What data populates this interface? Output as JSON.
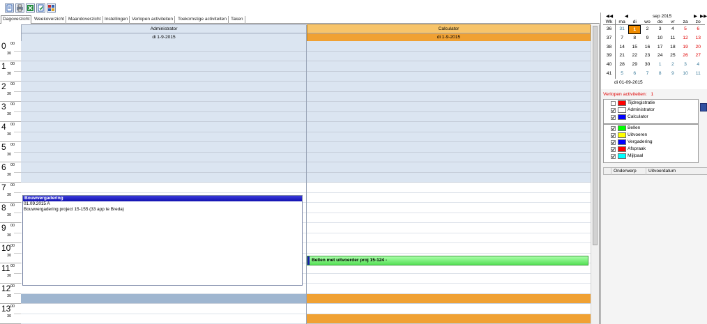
{
  "toolbar": {
    "icons": [
      "new-document-icon",
      "print-icon",
      "excel-export-icon",
      "refresh-icon",
      "grid-view-icon"
    ]
  },
  "tabs": [
    {
      "label": "Dagoverzicht",
      "active": true
    },
    {
      "label": "Weekoverzicht",
      "active": false
    },
    {
      "label": "Maandoverzicht",
      "active": false
    },
    {
      "label": "Instellingen",
      "active": false
    },
    {
      "label": "Verlopen activiteiten",
      "active": false
    },
    {
      "label": "Toekomstige activiteiten",
      "active": false
    },
    {
      "label": "Taken",
      "active": false
    }
  ],
  "columns": [
    {
      "name": "Administrator",
      "date": "di 1-9-2015"
    },
    {
      "name": "Calculator",
      "date": "di 1-9-2015"
    }
  ],
  "hours": [
    "0",
    "1",
    "2",
    "3",
    "4",
    "5",
    "6",
    "7",
    "8",
    "9",
    "10",
    "11",
    "12",
    "13"
  ],
  "minute_labels": {
    "full": "00",
    "half": "30"
  },
  "events": [
    {
      "title": "Bouwvergadering",
      "lines": [
        "01.09.2015 A",
        "Bouwvergadering project 15-155 (33 app te Breda)"
      ]
    },
    {
      "title": "Bellen met uitvoerder proj 15-124 -",
      "lines": []
    }
  ],
  "mini_calendar": {
    "month_label": "sep 2015",
    "header": [
      "Wk",
      "ma",
      "di",
      "wo",
      "do",
      "vr",
      "za",
      "zo"
    ],
    "weeks": [
      {
        "wk": "36",
        "days": [
          "31",
          "1",
          "2",
          "3",
          "4",
          "5",
          "6"
        ]
      },
      {
        "wk": "37",
        "days": [
          "7",
          "8",
          "9",
          "10",
          "11",
          "12",
          "13"
        ]
      },
      {
        "wk": "38",
        "days": [
          "14",
          "15",
          "16",
          "17",
          "18",
          "19",
          "20"
        ]
      },
      {
        "wk": "39",
        "days": [
          "21",
          "22",
          "23",
          "24",
          "25",
          "26",
          "27"
        ]
      },
      {
        "wk": "40",
        "days": [
          "28",
          "29",
          "30",
          "1",
          "2",
          "3",
          "4"
        ]
      },
      {
        "wk": "41",
        "days": [
          "5",
          "6",
          "7",
          "8",
          "9",
          "10",
          "11"
        ]
      }
    ],
    "selected_date": "di 01-09-2015"
  },
  "overdue": {
    "label": "Verlopen activiteiten:",
    "count": "1"
  },
  "resources": [
    {
      "label": "Tijdregistratie",
      "checked": false,
      "color": "#ff0000"
    },
    {
      "label": "Administrator",
      "checked": true,
      "color": "#ffffff"
    },
    {
      "label": "Calculator",
      "checked": true,
      "color": "#0000ff"
    }
  ],
  "activity_types": [
    {
      "label": "Bellen",
      "checked": true,
      "color": "#00ff00"
    },
    {
      "label": "Uitvoeren",
      "checked": true,
      "color": "#ffff00"
    },
    {
      "label": "Vergadering",
      "checked": true,
      "color": "#0000ff"
    },
    {
      "label": "Afspraak",
      "checked": true,
      "color": "#ff0000"
    },
    {
      "label": "Mijlpaal",
      "checked": true,
      "color": "#00ffff"
    }
  ],
  "task_list": {
    "columns": [
      "Onderwerp",
      "Uitvoerdatum"
    ]
  }
}
